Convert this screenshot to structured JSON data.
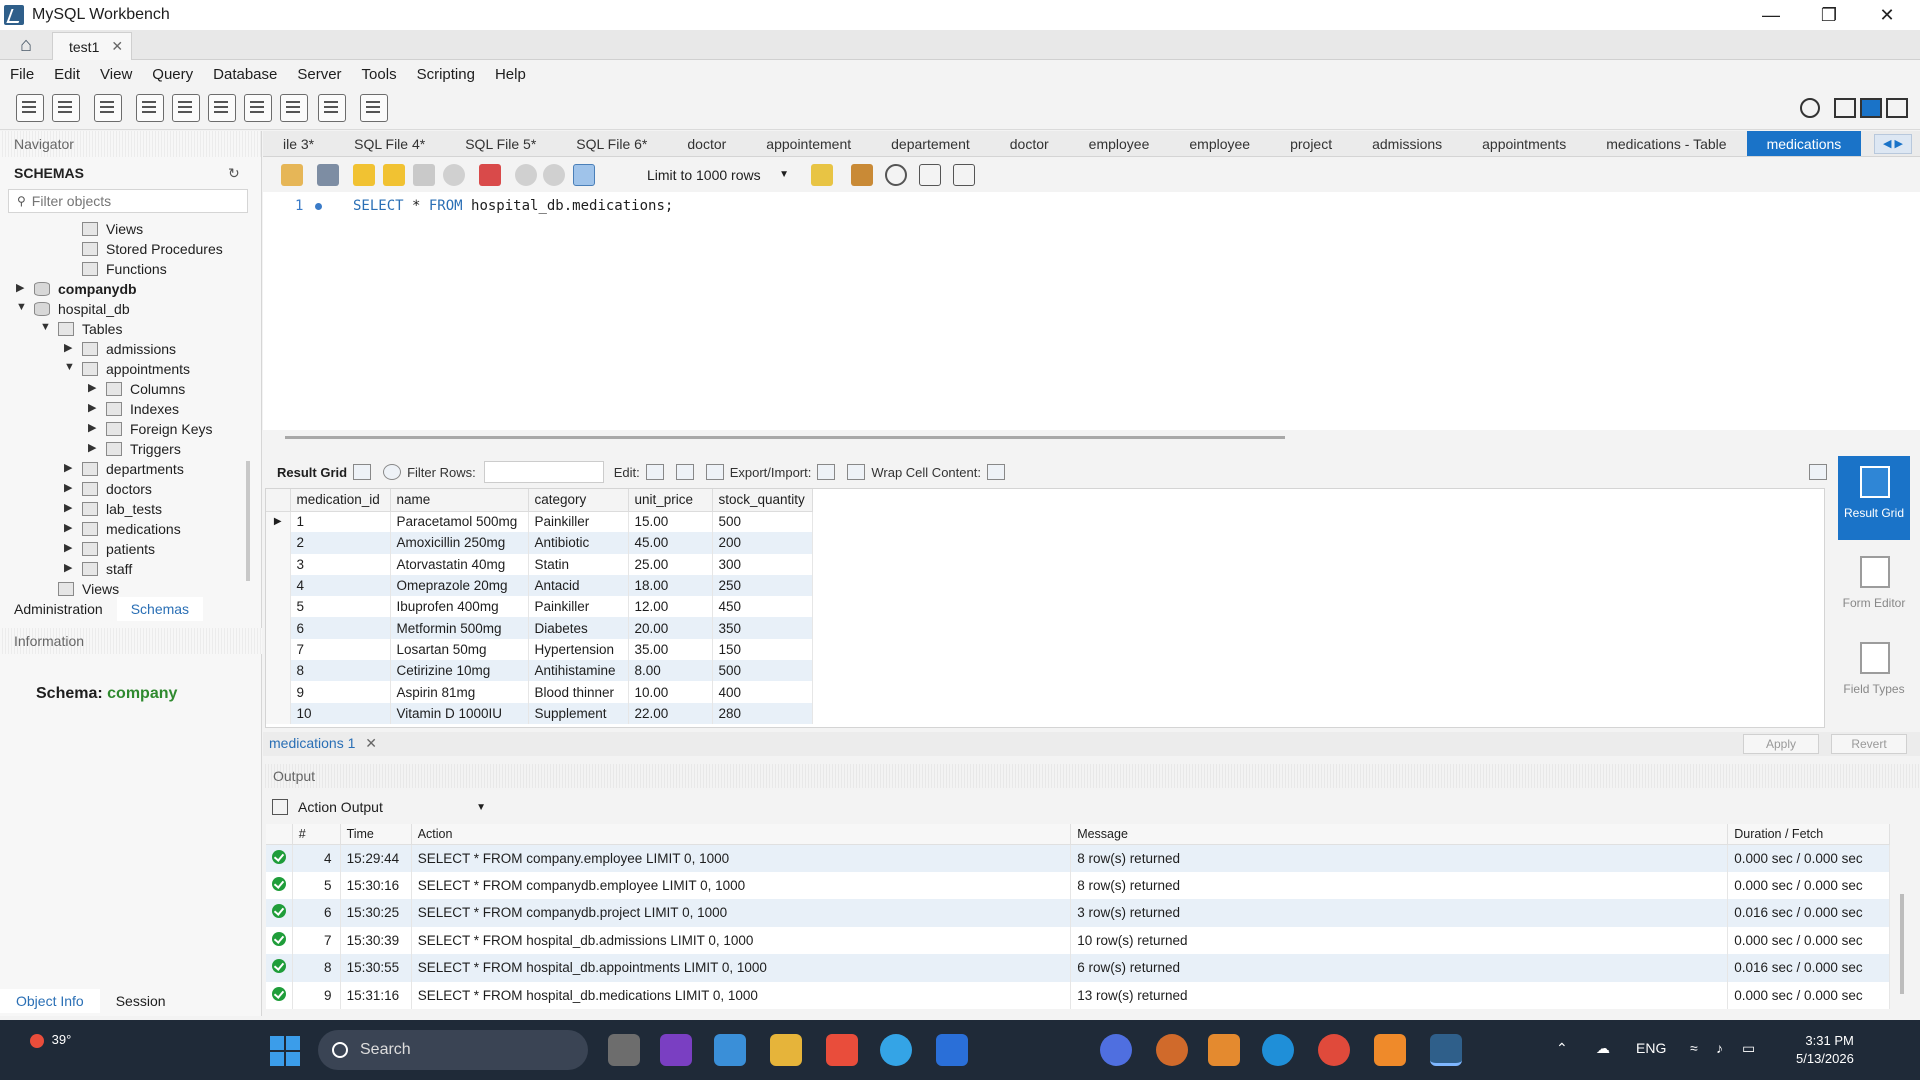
{
  "window": {
    "title": "MySQL Workbench"
  },
  "connection_tab": {
    "label": "test1"
  },
  "menu": [
    "File",
    "Edit",
    "View",
    "Query",
    "Database",
    "Server",
    "Tools",
    "Scripting",
    "Help"
  ],
  "navigator": {
    "header": "Navigator",
    "schemas_label": "SCHEMAS",
    "filter_placeholder": "Filter objects",
    "tree": [
      {
        "label": "Views",
        "depth": 2,
        "arrow": "",
        "icon": "folder",
        "bold": false
      },
      {
        "label": "Stored Procedures",
        "depth": 2,
        "arrow": "",
        "icon": "folder",
        "bold": false
      },
      {
        "label": "Functions",
        "depth": 2,
        "arrow": "",
        "icon": "folder",
        "bold": false
      },
      {
        "label": "companydb",
        "depth": 0,
        "arrow": "▶",
        "icon": "db",
        "bold": true
      },
      {
        "label": "hospital_db",
        "depth": 0,
        "arrow": "▼",
        "icon": "db",
        "bold": false
      },
      {
        "label": "Tables",
        "depth": 1,
        "arrow": "▼",
        "icon": "folder",
        "bold": false
      },
      {
        "label": "admissions",
        "depth": 2,
        "arrow": "▶",
        "icon": "table",
        "bold": false
      },
      {
        "label": "appointments",
        "depth": 2,
        "arrow": "▼",
        "icon": "table",
        "bold": false
      },
      {
        "label": "Columns",
        "depth": 3,
        "arrow": "▶",
        "icon": "folder",
        "bold": false
      },
      {
        "label": "Indexes",
        "depth": 3,
        "arrow": "▶",
        "icon": "folder",
        "bold": false
      },
      {
        "label": "Foreign Keys",
        "depth": 3,
        "arrow": "▶",
        "icon": "folder",
        "bold": false
      },
      {
        "label": "Triggers",
        "depth": 3,
        "arrow": "▶",
        "icon": "folder",
        "bold": false
      },
      {
        "label": "departments",
        "depth": 2,
        "arrow": "▶",
        "icon": "table",
        "bold": false
      },
      {
        "label": "doctors",
        "depth": 2,
        "arrow": "▶",
        "icon": "table",
        "bold": false
      },
      {
        "label": "lab_tests",
        "depth": 2,
        "arrow": "▶",
        "icon": "table",
        "bold": false
      },
      {
        "label": "medications",
        "depth": 2,
        "arrow": "▶",
        "icon": "table",
        "bold": false
      },
      {
        "label": "patients",
        "depth": 2,
        "arrow": "▶",
        "icon": "table",
        "bold": false
      },
      {
        "label": "staff",
        "depth": 2,
        "arrow": "▶",
        "icon": "table",
        "bold": false
      },
      {
        "label": "Views",
        "depth": 1,
        "arrow": "",
        "icon": "folder",
        "bold": false
      }
    ],
    "tabs": [
      "Administration",
      "Schemas"
    ],
    "information_header": "Information",
    "schema_info_label": "Schema:",
    "schema_info_value": "company",
    "bottom_tabs": [
      "Object Info",
      "Session"
    ]
  },
  "editor_tabs": [
    "ile 3*",
    "SQL File 4*",
    "SQL File 5*",
    "SQL File 6*",
    "doctor",
    "appointement",
    "departement",
    "doctor",
    "employee",
    "employee",
    "project",
    "admissions",
    "appointments",
    "medications - Table",
    "medications"
  ],
  "sql_toolbar": {
    "limit_label": "Limit to 1000 rows"
  },
  "editor": {
    "line_number": "1",
    "code_parts": {
      "kw1": "SELECT",
      "mid": " * ",
      "kw2": "FROM",
      "rest": " hospital_db.medications;"
    }
  },
  "result_toolbar": {
    "result_grid": "Result Grid",
    "filter_rows": "Filter Rows:",
    "edit": "Edit:",
    "export_import": "Export/Import:",
    "wrap": "Wrap Cell Content:"
  },
  "grid": {
    "columns": [
      "medication_id",
      "name",
      "category",
      "unit_price",
      "stock_quantity"
    ],
    "rows": [
      [
        "1",
        "Paracetamol 500mg",
        "Painkiller",
        "15.00",
        "500"
      ],
      [
        "2",
        "Amoxicillin 250mg",
        "Antibiotic",
        "45.00",
        "200"
      ],
      [
        "3",
        "Atorvastatin 40mg",
        "Statin",
        "25.00",
        "300"
      ],
      [
        "4",
        "Omeprazole 20mg",
        "Antacid",
        "18.00",
        "250"
      ],
      [
        "5",
        "Ibuprofen 400mg",
        "Painkiller",
        "12.00",
        "450"
      ],
      [
        "6",
        "Metformin 500mg",
        "Diabetes",
        "20.00",
        "350"
      ],
      [
        "7",
        "Losartan 50mg",
        "Hypertension",
        "35.00",
        "150"
      ],
      [
        "8",
        "Cetirizine 10mg",
        "Antihistamine",
        "8.00",
        "500"
      ],
      [
        "9",
        "Aspirin 81mg",
        "Blood thinner",
        "10.00",
        "400"
      ],
      [
        "10",
        "Vitamin D 1000IU",
        "Supplement",
        "22.00",
        "280"
      ]
    ]
  },
  "side_panel": {
    "result_grid": "Result Grid",
    "form_editor": "Form Editor",
    "field_types": "Field Types"
  },
  "result_tab": {
    "label": "medications 1",
    "apply": "Apply",
    "revert": "Revert"
  },
  "output": {
    "header": "Output",
    "selector": "Action Output",
    "columns": [
      "#",
      "Time",
      "Action",
      "Message",
      "Duration / Fetch"
    ],
    "rows": [
      [
        "4",
        "15:29:44",
        "SELECT * FROM company.employee LIMIT 0, 1000",
        "8 row(s) returned",
        "0.000 sec / 0.000 sec"
      ],
      [
        "5",
        "15:30:16",
        "SELECT * FROM companydb.employee LIMIT 0, 1000",
        "8 row(s) returned",
        "0.000 sec / 0.000 sec"
      ],
      [
        "6",
        "15:30:25",
        "SELECT * FROM companydb.project LIMIT 0, 1000",
        "3 row(s) returned",
        "0.016 sec / 0.000 sec"
      ],
      [
        "7",
        "15:30:39",
        "SELECT * FROM hospital_db.admissions LIMIT 0, 1000",
        "10 row(s) returned",
        "0.000 sec / 0.000 sec"
      ],
      [
        "8",
        "15:30:55",
        "SELECT * FROM hospital_db.appointments LIMIT 0, 1000",
        "6 row(s) returned",
        "0.016 sec / 0.000 sec"
      ],
      [
        "9",
        "15:31:16",
        "SELECT * FROM hospital_db.medications LIMIT 0, 1000",
        "13 row(s) returned",
        "0.000 sec / 0.000 sec"
      ]
    ]
  },
  "taskbar": {
    "weather": "39°",
    "search_placeholder": "Search",
    "lang": "ENG",
    "time": "3:31 PM",
    "date": "5/13/2026"
  },
  "colors": {
    "accent": "#1a73c8",
    "success": "#1f9d3a",
    "schema_value": "#2f8a2f"
  }
}
